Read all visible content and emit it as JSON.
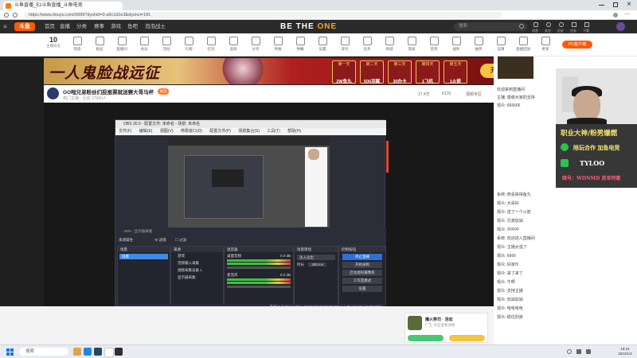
{
  "browser": {
    "tab_title": "斗鱼直播_Ez斗鱼直播_斗鱼电竞",
    "url": "https://www.douyu.com/9999?dyshid=0-a9c1d2e3&dyshci=181",
    "close_glyph": "×"
  },
  "site": {
    "logo_text": "斗鱼",
    "nav": [
      "首页",
      "直播",
      "分类",
      "赛事",
      "游戏",
      "鱼吧",
      "泡泡战士"
    ],
    "center_banner": {
      "prefix": "BE THE ",
      "highlight": "ONE"
    },
    "search_placeholder": "搜索",
    "pc_button": "PC客户端",
    "top_right_icons": [
      "消息",
      "关注",
      "历史",
      "任务",
      "下载"
    ]
  },
  "categories": {
    "rank_number": "10",
    "rank_label": "主播排名",
    "items": [
      "贵族",
      "粉丝",
      "直播间",
      "会员",
      "活动",
      "礼物",
      "红包",
      "道具",
      "分享",
      "举报",
      "弹幕",
      "设置",
      "背包",
      "任务",
      "商城",
      "等级",
      "签到",
      "福利",
      "抽奖",
      "竞猜",
      "直播回放",
      "更多"
    ]
  },
  "banner": {
    "title": "一人鬼脸战远征",
    "prizes": [
      {
        "label": "第一天",
        "reward": "2W鱼丸"
      },
      {
        "label": "第二天",
        "reward": "500羽翼"
      },
      {
        "label": "第三天",
        "reward": "30办卡"
      },
      {
        "label": "第四天",
        "reward": "1飞机"
      },
      {
        "label": "第五天",
        "reward": "1火箭"
      }
    ],
    "start_button": "开始游戏"
  },
  "stream": {
    "title": "GO啦兄弟粉丝们投报票就送赛大哥马杯",
    "subtitle": "热门主播 · 互动 17940人",
    "follow_button": "关注",
    "stats": [
      "17.4万",
      "6176",
      "视频专区"
    ]
  },
  "obs": {
    "title": "OBS 30.0 - 配置文件: 未命名 - 场景: 未命名",
    "menu": [
      "文件(F)",
      "编辑(E)",
      "视图(V)",
      "停靠窗口(D)",
      "配置文件(P)",
      "场景集合(S)",
      "工具(T)",
      "帮助(H)"
    ],
    "status_left": "- 30% - 显示器采集",
    "tabs": [
      "来源属性",
      "⚙ 滤镜",
      "☐ 过滤"
    ],
    "docks": {
      "scenes": {
        "title": "场景",
        "items": [
          "场景"
        ]
      },
      "sources": {
        "title": "来源",
        "items": [
          "游戏",
          "音频输入采集",
          "视频采集设备 1",
          "显示器采集"
        ]
      },
      "mixer": {
        "title": "混音器",
        "tracks": [
          "桌面音频",
          "麦克风"
        ],
        "levels": [
          "0.0 dB",
          "0.0 dB"
        ]
      },
      "transitions": {
        "title": "场景转场",
        "type": "淡入淡出",
        "duration_label": "时长",
        "duration": "300 ms"
      },
      "controls": {
        "title": "控制按钮",
        "buttons": [
          "停止直播",
          "开始录制",
          "启动虚拟摄像机",
          "工作室模式",
          "设置"
        ]
      }
    },
    "footer": "丢帧 0 (0.0%)  0 kbps  00:00:00  00:00:00  CPU: 1.3%  60.00 / 60.00 FPS"
  },
  "chat": {
    "lines": [
      "欢迎来到直播间",
      "主播: 感谢大家的支持",
      "观众: 666666",
      "系统: 恭喜获得鱼丸",
      "观众: 大哥好",
      "观众: 送了一个火箭",
      "观众: 兄弟加油",
      "观众: 冲冲冲",
      "系统: 欢迎进入直播间",
      "观众: 主播太强了",
      "观众: 6666",
      "观众: 好家伙",
      "观众: 来了来了",
      "观众: 牛啊",
      "观众: 支持主播",
      "观众: 加油加油",
      "观众: 哈哈哈哈",
      "观众: 稳住别浪"
    ],
    "bottom_card": {
      "title": "魔火祭司 · 活动",
      "sub": "广告 点击查看详情"
    }
  },
  "promo": {
    "line1": "职业大神/粉男爆燃",
    "line2": "陪玩合作 加鱼电竞",
    "line3": "TYLOO",
    "line4": "暗号：WDNMD 首单特惠"
  },
  "taskbar": {
    "search_placeholder": "搜索",
    "time": "18:24",
    "date": "2024/1/4"
  },
  "colors": {
    "accent_orange": "#ff5a00",
    "obs_blue": "#2f6fd8",
    "obs_bg": "#2b2e38"
  }
}
